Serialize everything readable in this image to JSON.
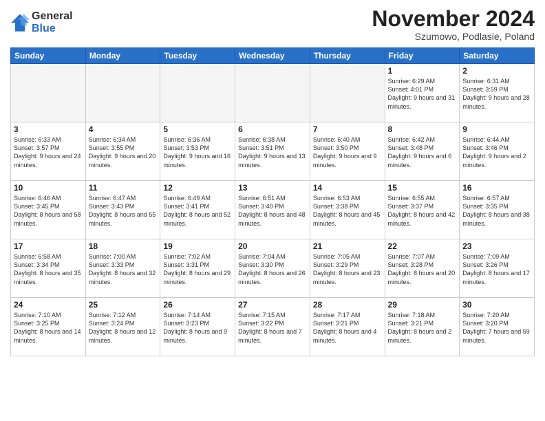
{
  "logo": {
    "general": "General",
    "blue": "Blue"
  },
  "header": {
    "title": "November 2024",
    "location": "Szumowo, Podlasie, Poland"
  },
  "weekdays": [
    "Sunday",
    "Monday",
    "Tuesday",
    "Wednesday",
    "Thursday",
    "Friday",
    "Saturday"
  ],
  "weeks": [
    [
      {
        "day": "",
        "info": ""
      },
      {
        "day": "",
        "info": ""
      },
      {
        "day": "",
        "info": ""
      },
      {
        "day": "",
        "info": ""
      },
      {
        "day": "",
        "info": ""
      },
      {
        "day": "1",
        "info": "Sunrise: 6:29 AM\nSunset: 4:01 PM\nDaylight: 9 hours and 31 minutes."
      },
      {
        "day": "2",
        "info": "Sunrise: 6:31 AM\nSunset: 3:59 PM\nDaylight: 9 hours and 28 minutes."
      }
    ],
    [
      {
        "day": "3",
        "info": "Sunrise: 6:33 AM\nSunset: 3:57 PM\nDaylight: 9 hours and 24 minutes."
      },
      {
        "day": "4",
        "info": "Sunrise: 6:34 AM\nSunset: 3:55 PM\nDaylight: 9 hours and 20 minutes."
      },
      {
        "day": "5",
        "info": "Sunrise: 6:36 AM\nSunset: 3:53 PM\nDaylight: 9 hours and 16 minutes."
      },
      {
        "day": "6",
        "info": "Sunrise: 6:38 AM\nSunset: 3:51 PM\nDaylight: 9 hours and 13 minutes."
      },
      {
        "day": "7",
        "info": "Sunrise: 6:40 AM\nSunset: 3:50 PM\nDaylight: 9 hours and 9 minutes."
      },
      {
        "day": "8",
        "info": "Sunrise: 6:42 AM\nSunset: 3:48 PM\nDaylight: 9 hours and 6 minutes."
      },
      {
        "day": "9",
        "info": "Sunrise: 6:44 AM\nSunset: 3:46 PM\nDaylight: 9 hours and 2 minutes."
      }
    ],
    [
      {
        "day": "10",
        "info": "Sunrise: 6:46 AM\nSunset: 3:45 PM\nDaylight: 8 hours and 58 minutes."
      },
      {
        "day": "11",
        "info": "Sunrise: 6:47 AM\nSunset: 3:43 PM\nDaylight: 8 hours and 55 minutes."
      },
      {
        "day": "12",
        "info": "Sunrise: 6:49 AM\nSunset: 3:41 PM\nDaylight: 8 hours and 52 minutes."
      },
      {
        "day": "13",
        "info": "Sunrise: 6:51 AM\nSunset: 3:40 PM\nDaylight: 8 hours and 48 minutes."
      },
      {
        "day": "14",
        "info": "Sunrise: 6:53 AM\nSunset: 3:38 PM\nDaylight: 8 hours and 45 minutes."
      },
      {
        "day": "15",
        "info": "Sunrise: 6:55 AM\nSunset: 3:37 PM\nDaylight: 8 hours and 42 minutes."
      },
      {
        "day": "16",
        "info": "Sunrise: 6:57 AM\nSunset: 3:35 PM\nDaylight: 8 hours and 38 minutes."
      }
    ],
    [
      {
        "day": "17",
        "info": "Sunrise: 6:58 AM\nSunset: 3:34 PM\nDaylight: 8 hours and 35 minutes."
      },
      {
        "day": "18",
        "info": "Sunrise: 7:00 AM\nSunset: 3:33 PM\nDaylight: 8 hours and 32 minutes."
      },
      {
        "day": "19",
        "info": "Sunrise: 7:02 AM\nSunset: 3:31 PM\nDaylight: 8 hours and 29 minutes."
      },
      {
        "day": "20",
        "info": "Sunrise: 7:04 AM\nSunset: 3:30 PM\nDaylight: 8 hours and 26 minutes."
      },
      {
        "day": "21",
        "info": "Sunrise: 7:05 AM\nSunset: 3:29 PM\nDaylight: 8 hours and 23 minutes."
      },
      {
        "day": "22",
        "info": "Sunrise: 7:07 AM\nSunset: 3:28 PM\nDaylight: 8 hours and 20 minutes."
      },
      {
        "day": "23",
        "info": "Sunrise: 7:09 AM\nSunset: 3:26 PM\nDaylight: 8 hours and 17 minutes."
      }
    ],
    [
      {
        "day": "24",
        "info": "Sunrise: 7:10 AM\nSunset: 3:25 PM\nDaylight: 8 hours and 14 minutes."
      },
      {
        "day": "25",
        "info": "Sunrise: 7:12 AM\nSunset: 3:24 PM\nDaylight: 8 hours and 12 minutes."
      },
      {
        "day": "26",
        "info": "Sunrise: 7:14 AM\nSunset: 3:23 PM\nDaylight: 8 hours and 9 minutes."
      },
      {
        "day": "27",
        "info": "Sunrise: 7:15 AM\nSunset: 3:22 PM\nDaylight: 8 hours and 7 minutes."
      },
      {
        "day": "28",
        "info": "Sunrise: 7:17 AM\nSunset: 3:21 PM\nDaylight: 8 hours and 4 minutes."
      },
      {
        "day": "29",
        "info": "Sunrise: 7:18 AM\nSunset: 3:21 PM\nDaylight: 8 hours and 2 minutes."
      },
      {
        "day": "30",
        "info": "Sunrise: 7:20 AM\nSunset: 3:20 PM\nDaylight: 7 hours and 59 minutes."
      }
    ]
  ]
}
